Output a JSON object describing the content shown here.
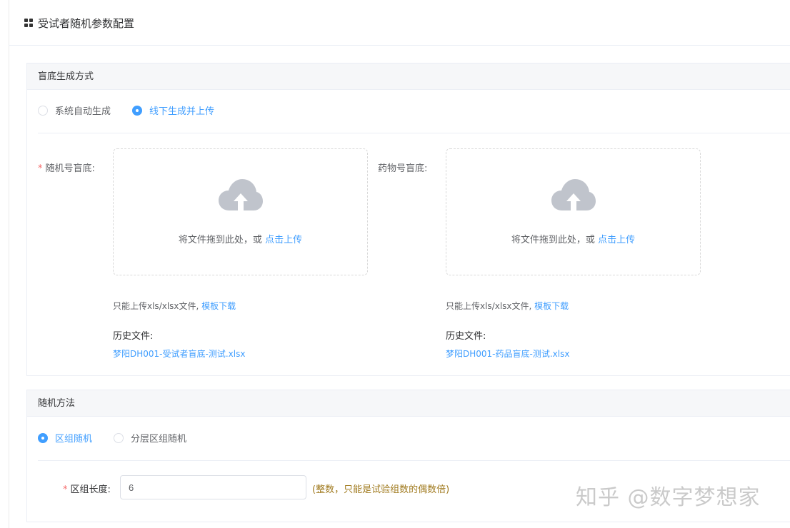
{
  "header": {
    "title": "受试者随机参数配置"
  },
  "blind_section": {
    "title": "盲底生成方式",
    "options": [
      {
        "label": "系统自动生成",
        "checked": false
      },
      {
        "label": "线下生成并上传",
        "checked": true
      }
    ],
    "random_upload": {
      "label": "随机号盲底:",
      "required": "*",
      "drop_text": "将文件拖到此处，或 ",
      "click_text": "点击上传",
      "tip_text": "只能上传xls/xlsx文件, ",
      "template_link": "模板下载",
      "history_title": "历史文件:",
      "history_file": "梦阳DH001-受试者盲底-测试.xlsx"
    },
    "drug_upload": {
      "label": "药物号盲底:",
      "drop_text": "将文件拖到此处，或 ",
      "click_text": "点击上传",
      "tip_text": "只能上传xls/xlsx文件, ",
      "template_link": "模板下载",
      "history_title": "历史文件:",
      "history_file": "梦阳DH001-药品盲底-测试.xlsx"
    }
  },
  "method_section": {
    "title": "随机方法",
    "options": [
      {
        "label": "区组随机",
        "checked": true
      },
      {
        "label": "分层区组随机",
        "checked": false
      }
    ],
    "block_length": {
      "required": "*",
      "label": "区组长度:",
      "value": "6",
      "hint": "(整数，只能是试验组数的偶数倍)"
    }
  },
  "watermark": "知乎 @数字梦想家",
  "colors": {
    "accent": "#409eff",
    "required": "#f56c6c",
    "icon_gray": "#c0c4cc"
  }
}
